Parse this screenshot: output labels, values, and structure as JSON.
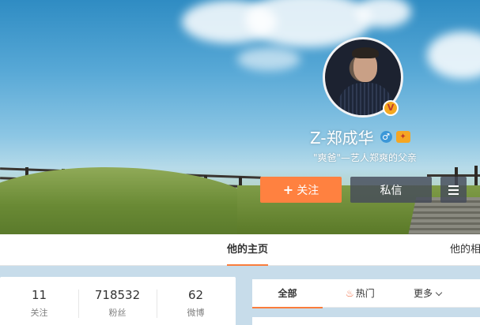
{
  "profile": {
    "name": "Z-郑成华",
    "gender_icon": "male-icon",
    "verified_badge": "V",
    "member_icon": "vip-icon",
    "bio": "\"爽爸\"—艺人郑爽的父亲"
  },
  "actions": {
    "follow_label": "关注",
    "message_label": "私信",
    "menu_icon": "hamburger-icon"
  },
  "tabs": {
    "home": "他的主页",
    "photos": "他的相"
  },
  "stats": [
    {
      "value": "11",
      "label": "关注"
    },
    {
      "value": "718532",
      "label": "粉丝"
    },
    {
      "value": "62",
      "label": "微博"
    }
  ],
  "feed_tabs": {
    "all": "全部",
    "hot": "热门",
    "more": "更多"
  },
  "colors": {
    "accent": "#ff8140",
    "tab_underline": "#fa7d3c",
    "page_bg": "#c7dcea"
  }
}
